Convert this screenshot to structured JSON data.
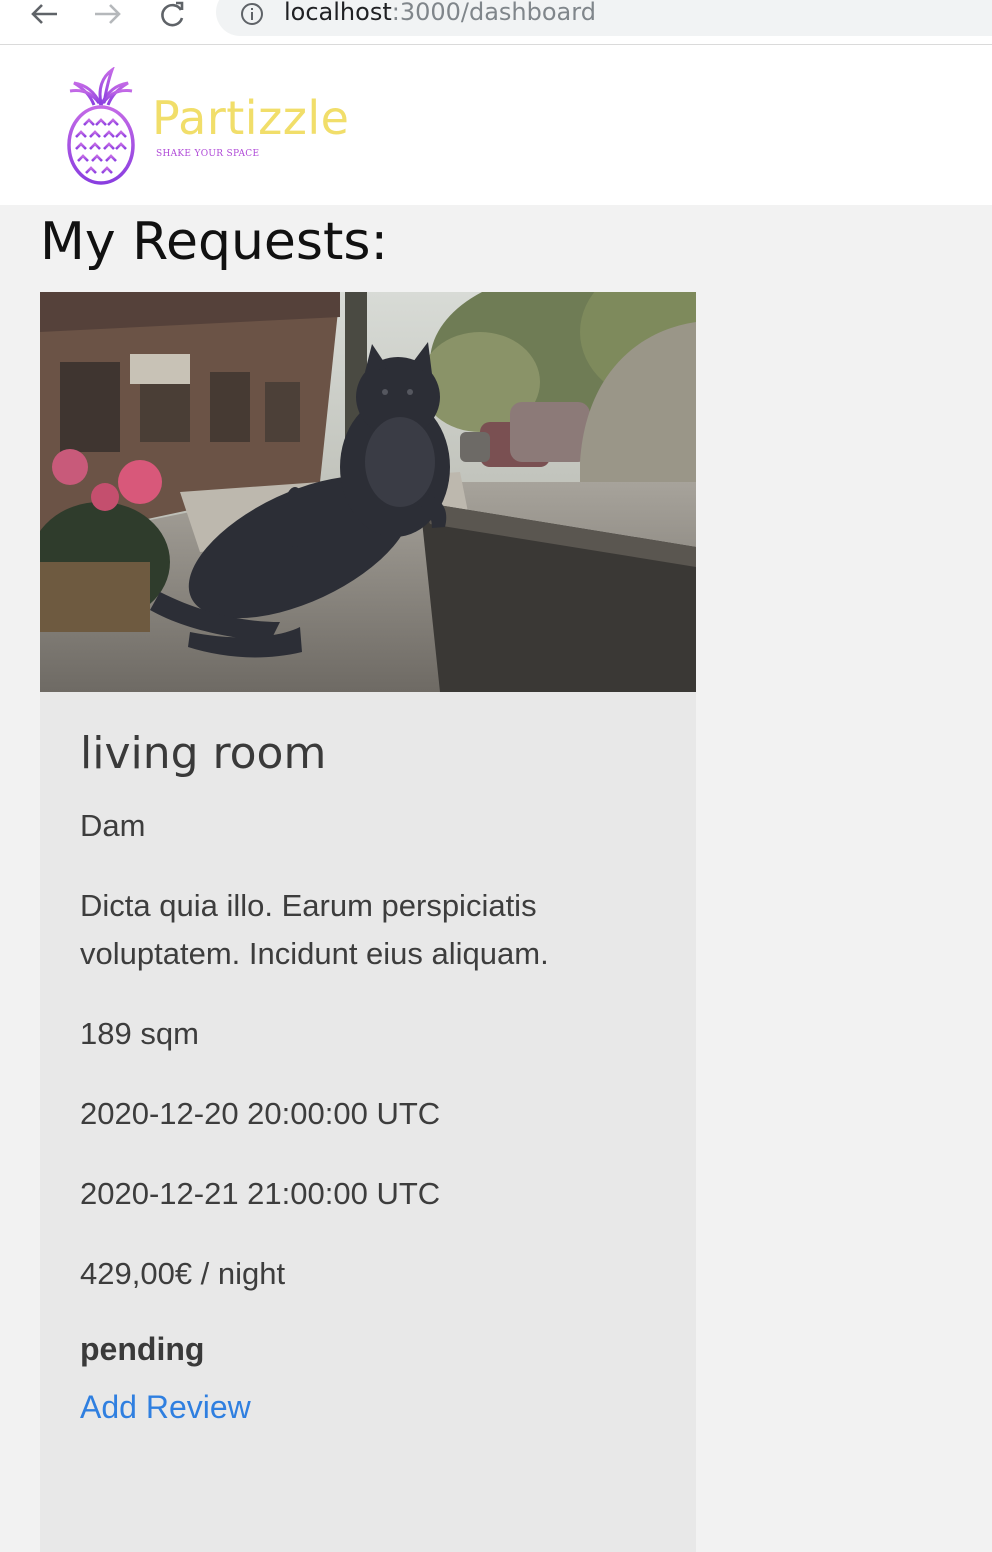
{
  "browser": {
    "url_host": "localhost",
    "url_path": ":3000/dashboard"
  },
  "header": {
    "brand": "Partizzle",
    "tagline": "SHAKE YOUR SPACE",
    "logo_icon": "pineapple-logo",
    "colors": {
      "brand_yellow": "#f1de6a",
      "logo_purple": "#b04ad8"
    }
  },
  "page": {
    "title": "My Requests:"
  },
  "requests": [
    {
      "image": "cat-statue-street-photo",
      "title": "living room",
      "city": "Dam",
      "description": "Dicta quia illo. Earum perspiciatis voluptatem. Incidunt eius aliquam.",
      "size": "189 sqm",
      "start": "2020-12-20 20:00:00 UTC",
      "end": "2020-12-21 21:00:00 UTC",
      "price": "429,00€ / night",
      "status": "pending",
      "action_label": "Add Review"
    }
  ]
}
